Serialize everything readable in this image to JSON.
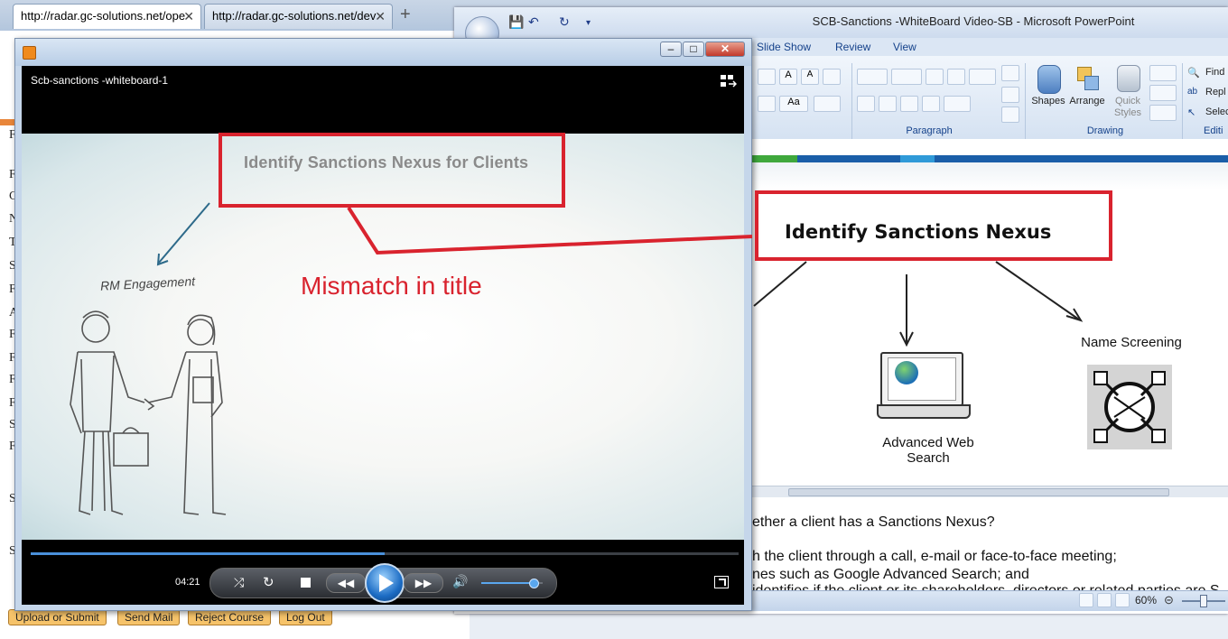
{
  "browser": {
    "tabs": [
      {
        "label": "http://radar.gc-solutions.net/ope",
        "active": true
      },
      {
        "label": "http://radar.gc-solutions.net/dev",
        "active": false
      }
    ],
    "new_tab": "+",
    "close_glyph": "✕",
    "left_letters": [
      "F",
      "F",
      "C",
      "N",
      "T",
      "S",
      "F",
      "A",
      "F",
      "F",
      "F",
      "F",
      "S",
      "F",
      "S",
      "S"
    ],
    "bottom_buttons": [
      "Upload or Submit",
      "Send Mail",
      "Reject Course",
      "Log Out"
    ]
  },
  "ppt": {
    "title": "SCB-Sanctions -WhiteBoard Video-SB - Microsoft PowerPoint",
    "ribbon_tabs": [
      "Slide Show",
      "Review",
      "View"
    ],
    "groups": {
      "paragraph": "Paragraph",
      "drawing": "Drawing",
      "editing": "Editi"
    },
    "drawing_buttons": {
      "shapes": "Shapes",
      "arrange": "Arrange",
      "quick_styles_1": "Quick",
      "quick_styles_2": "Styles"
    },
    "editing_buttons": {
      "find": "Find",
      "replace": "Repl",
      "select": "Selec"
    },
    "slide": {
      "heading": "Identify Sanctions Nexus",
      "node_left_1": "Advanced Web",
      "node_left_2": "Search",
      "node_right": "Name Screening"
    },
    "notes": [
      "ether a client has a Sanctions Nexus?",
      "h the client through a call, e-mail or face-to-face meeting;",
      "nes  such  as Google Advanced Search; and",
      "identifies if the client or its shareholders, directors or related parties are S"
    ],
    "zoom": "60%"
  },
  "player": {
    "title": "Scb-sanctions -whiteboard-1",
    "time": "04:21",
    "progress": 0.5,
    "volume": 0.85,
    "video": {
      "title": "Identify Sanctions Nexus for Clients",
      "caption": "RM Engagement"
    }
  },
  "annotation": {
    "text": "Mismatch in title",
    "color": "#d9232e"
  }
}
